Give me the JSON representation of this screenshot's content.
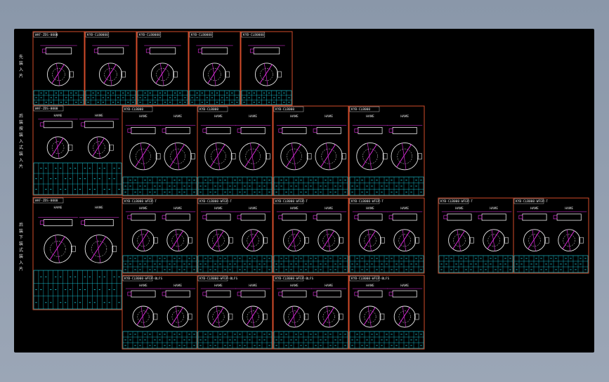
{
  "viewport": {
    "background_top": "#8a97a9",
    "background_bottom": "#9ba6b6",
    "drawing_area_color": "#000000"
  },
  "colors": {
    "frame": "#d24b2a",
    "table": "#19d6e6",
    "part": "#e9e9e9",
    "accent": "#e62ee6",
    "title_text": "#f0f0f0"
  },
  "row_labels": [
    {
      "id": "row-1",
      "text": "先 装 入 片"
    },
    {
      "id": "row-2",
      "text": "后 装 按 装 入 式 装 入 片"
    },
    {
      "id": "row-3",
      "text": "后 装 下 装 式 装 入 片"
    }
  ],
  "sheet_titles": {
    "detail": "WAF-ZDS-0000",
    "detail_b": "WAF-ZDS-0000",
    "size": "KYB-CLB0000",
    "size_s": "KYB-CLB000",
    "size_long": "KYB-CLB000-WFEP-T",
    "size_long_b": "KYB-CLB000-WFEP-BLFS"
  },
  "view_labels": {
    "left_view": "HAME",
    "right_view": "HAME"
  }
}
